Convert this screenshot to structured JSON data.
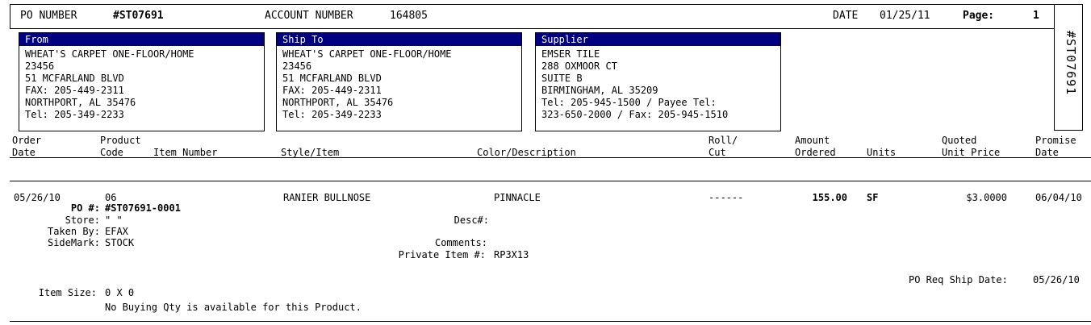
{
  "header": {
    "po_label": "PO NUMBER",
    "po_value": "#ST07691",
    "account_label": "ACCOUNT NUMBER",
    "account_value": "164805",
    "date_label": "DATE",
    "date_value": "01/25/11",
    "page_label": "Page:",
    "page_value": "1",
    "side_po": "#ST07691"
  },
  "from": {
    "title": "From",
    "lines": [
      "WHEAT'S CARPET ONE-FLOOR/HOME",
      "23456",
      "51 MCFARLAND BLVD",
      "FAX: 205-449-2311",
      "NORTHPORT, AL    35476",
      "Tel: 205-349-2233"
    ]
  },
  "ship_to": {
    "title": "Ship To",
    "lines": [
      "WHEAT'S CARPET ONE-FLOOR/HOME",
      "23456",
      "51 MCFARLAND BLVD",
      "FAX: 205-449-2311",
      "NORTHPORT, AL    35476",
      "Tel: 205-349-2233"
    ]
  },
  "supplier": {
    "title": "Supplier",
    "lines": [
      "EMSER TILE",
      "288 OXMOOR CT",
      "SUITE B",
      "BIRMINGHAM, AL  35209",
      "Tel: 205-945-1500 / Payee Tel:",
      "323-650-2000 / Fax: 205-945-1510"
    ]
  },
  "columns": {
    "order_date": [
      "Order",
      "Date"
    ],
    "product_code": [
      "Product",
      "Code"
    ],
    "item_number": "Item Number",
    "style_item": "Style/Item",
    "color_desc": "Color/Description",
    "roll_cut": [
      "Roll/",
      "Cut"
    ],
    "amount": [
      "Amount",
      "Ordered"
    ],
    "units": "Units",
    "unit_price": [
      "Quoted",
      "Unit Price"
    ],
    "promise": [
      "Promise",
      "Date"
    ]
  },
  "line_item": {
    "order_date": "05/26/10",
    "product_code": "06",
    "style": "RANIER BULLNOSE",
    "color": "PINNACLE",
    "roll_cut": "------",
    "amount": "155.00",
    "units": "SF",
    "unit_price": "$3.0000",
    "promise_date": "06/04/10",
    "po_label": "PO #:",
    "po_value": "#ST07691-0001",
    "store_label": "Store:",
    "store_value": "\" \"",
    "taken_by_label": "Taken By:",
    "taken_by_value": "EFAX",
    "sidemark_label": "SideMark:",
    "sidemark_value": "STOCK",
    "desc_label": "Desc#:",
    "comments_label": "Comments:",
    "private_item_label": "Private Item #:",
    "private_item_value": "RP3X13",
    "ship_date_label": "PO Req Ship Date:",
    "ship_date_value": "05/26/10",
    "item_size_label": "Item Size:",
    "item_size_value": "0 X 0",
    "note": "No Buying Qty is available for this Product."
  }
}
